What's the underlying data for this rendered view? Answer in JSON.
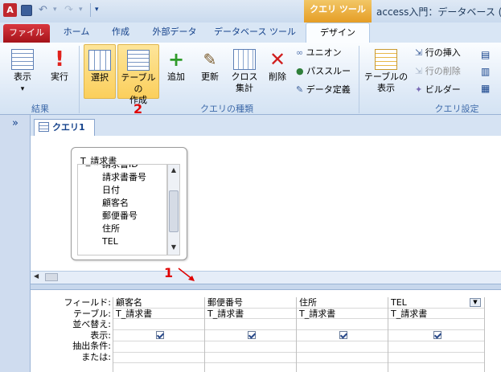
{
  "window": {
    "app_icon": "A",
    "ctx_tab": "クエリ ツール",
    "title": "access入門：データベース (Acc"
  },
  "tabs": [
    "ファイル",
    "ホーム",
    "作成",
    "外部データ",
    "データベース ツール",
    "デザイン"
  ],
  "ribbon": {
    "results": {
      "view": "表示",
      "view_arrow": "▾",
      "run": "実行",
      "label": "結果"
    },
    "query_type": {
      "select": "選択",
      "maketable_1": "テーブルの",
      "maketable_2": "作成",
      "append": "追加",
      "update": "更新",
      "crosstab_1": "クロス",
      "crosstab_2": "集計",
      "delete": "削除",
      "union": "ユニオン",
      "passthrough": "パススルー",
      "datadef": "データ定義",
      "label": "クエリの種類"
    },
    "setup": {
      "showtable_1": "テーブルの",
      "showtable_2": "表示",
      "insert_row": "行の挿入",
      "delete_row": "行の削除",
      "builder": "ビルダー",
      "label": "クエリ設定"
    }
  },
  "annotations": {
    "one": "1",
    "two": "2"
  },
  "nav": {
    "chevron": "»"
  },
  "query_tab": "クエリ1",
  "table": {
    "title": "T_請求書",
    "fields": [
      "請求書ID",
      "請求書番号",
      "日付",
      "顧客名",
      "郵便番号",
      "住所",
      "TEL"
    ]
  },
  "grid": {
    "labels": [
      "フィールド:",
      "テーブル:",
      "並べ替え:",
      "表示:",
      "抽出条件:",
      "または:"
    ],
    "columns": [
      {
        "field": "顧客名",
        "table": "T_請求書",
        "show": true
      },
      {
        "field": "郵便番号",
        "table": "T_請求書",
        "show": true
      },
      {
        "field": "住所",
        "table": "T_請求書",
        "show": true
      },
      {
        "field": "TEL",
        "table": "T_請求書",
        "show": true
      }
    ]
  },
  "colors": {
    "accent": "#fbcf5c",
    "file_tab": "#c8262e",
    "context": "#e8a83a",
    "annotation": "#e00000"
  }
}
